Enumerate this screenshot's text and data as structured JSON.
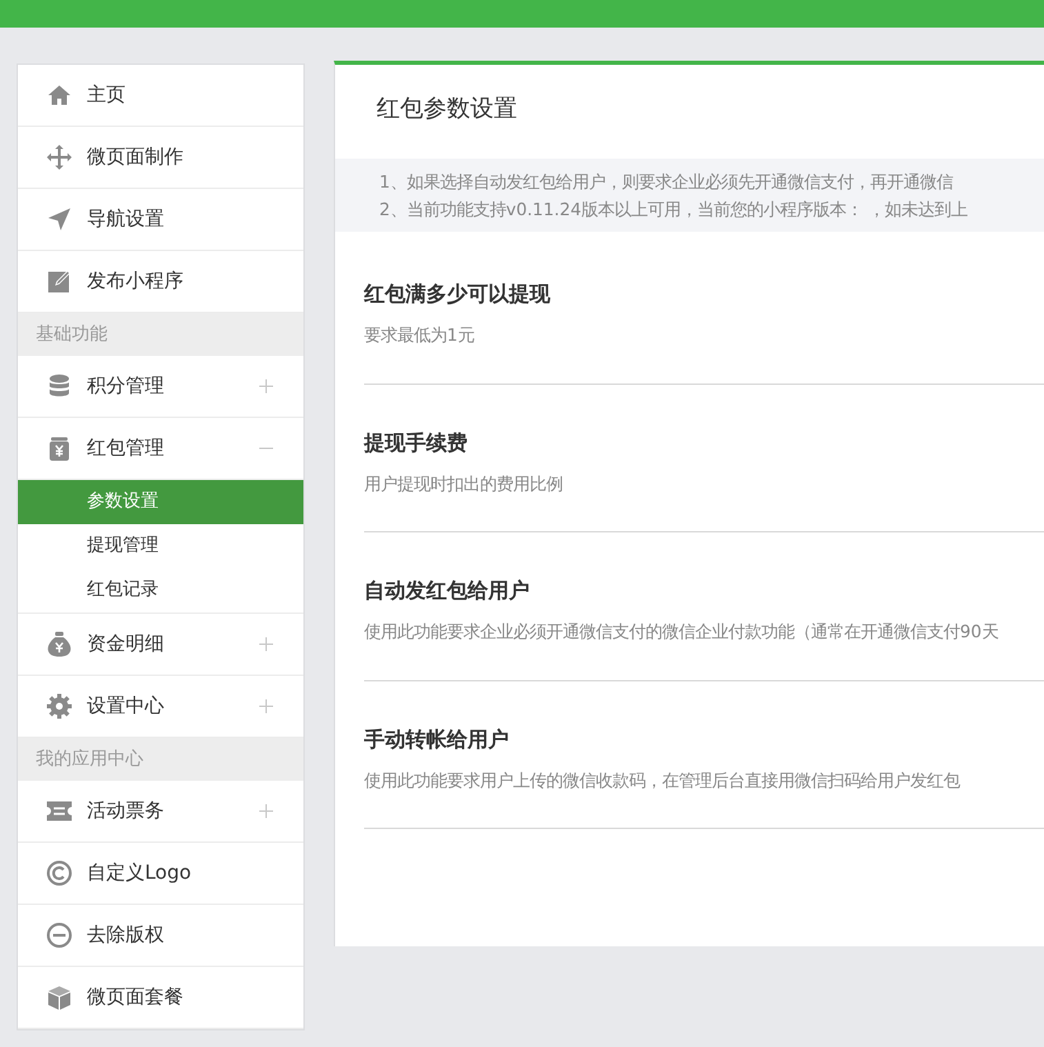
{
  "sidebar": {
    "items": [
      {
        "kind": "item",
        "label": "主页"
      },
      {
        "kind": "item",
        "label": "微页面制作"
      },
      {
        "kind": "item",
        "label": "导航设置"
      },
      {
        "kind": "item",
        "label": "发布小程序"
      },
      {
        "kind": "header",
        "label": "基础功能"
      },
      {
        "kind": "item",
        "label": "积分管理",
        "expanded": false
      },
      {
        "kind": "item",
        "label": "红包管理",
        "expanded": true
      },
      {
        "kind": "sub",
        "label": "参数设置",
        "selected": true
      },
      {
        "kind": "sub",
        "label": "提现管理",
        "selected": false
      },
      {
        "kind": "sub",
        "label": "红包记录",
        "selected": false
      },
      {
        "kind": "item",
        "label": "资金明细",
        "expanded": false
      },
      {
        "kind": "item",
        "label": "设置中心",
        "expanded": false
      },
      {
        "kind": "header",
        "label": "我的应用中心"
      },
      {
        "kind": "item",
        "label": "活动票务",
        "expanded": false
      },
      {
        "kind": "item",
        "label": "自定义Logo"
      },
      {
        "kind": "item",
        "label": "去除版权"
      },
      {
        "kind": "item",
        "label": "微页面套餐"
      }
    ]
  },
  "panel": {
    "title": "红包参数设置",
    "notes": [
      "1、如果选择自动发红包给用户，则要求企业必须先开通微信支付，再开通微信",
      "2、当前功能支持v0.11.24版本以上可用，当前您的小程序版本： ，如未达到上"
    ],
    "settings": [
      {
        "title": "红包满多少可以提现",
        "description": "要求最低为1元"
      },
      {
        "title": "提现手续费",
        "description": "用户提现时扣出的费用比例"
      },
      {
        "title": "自动发红包给用户",
        "description": "使用此功能要求企业必须开通微信支付的微信企业付款功能（通常在开通微信支付90天"
      },
      {
        "title": "手动转帐给用户",
        "description": "使用此功能要求用户上传的微信收款码，在管理后台直接用微信扫码给用户发红包"
      }
    ]
  }
}
